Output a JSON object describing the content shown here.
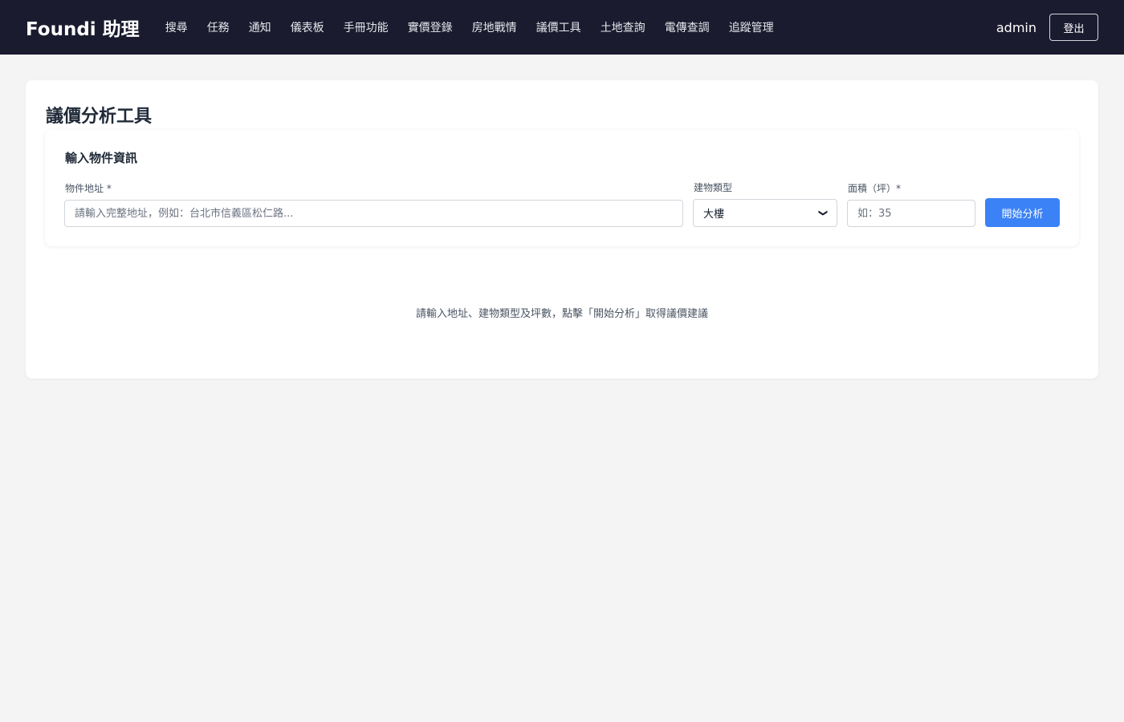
{
  "nav": {
    "brand": "Foundi 助理",
    "links": [
      "搜尋",
      "任務",
      "通知",
      "儀表板",
      "手冊功能",
      "實價登錄",
      "房地戰情",
      "議價工具",
      "土地查詢",
      "電傳查調",
      "追蹤管理"
    ],
    "username": "admin",
    "logout_label": "登出"
  },
  "page": {
    "title": "議價分析工具",
    "form_title": "輸入物件資訊",
    "address": {
      "label": "物件地址 *",
      "placeholder": "請輸入完整地址，例如：台北市信義區松仁路...",
      "value": ""
    },
    "building_type": {
      "label": "建物類型",
      "selected": "大樓"
    },
    "area": {
      "label": "面積（坪）*",
      "placeholder": "如：35",
      "value": ""
    },
    "analyze_label": "開始分析",
    "hint": "請輸入地址、建物類型及坪數，點擊「開始分析」取得議價建議"
  }
}
